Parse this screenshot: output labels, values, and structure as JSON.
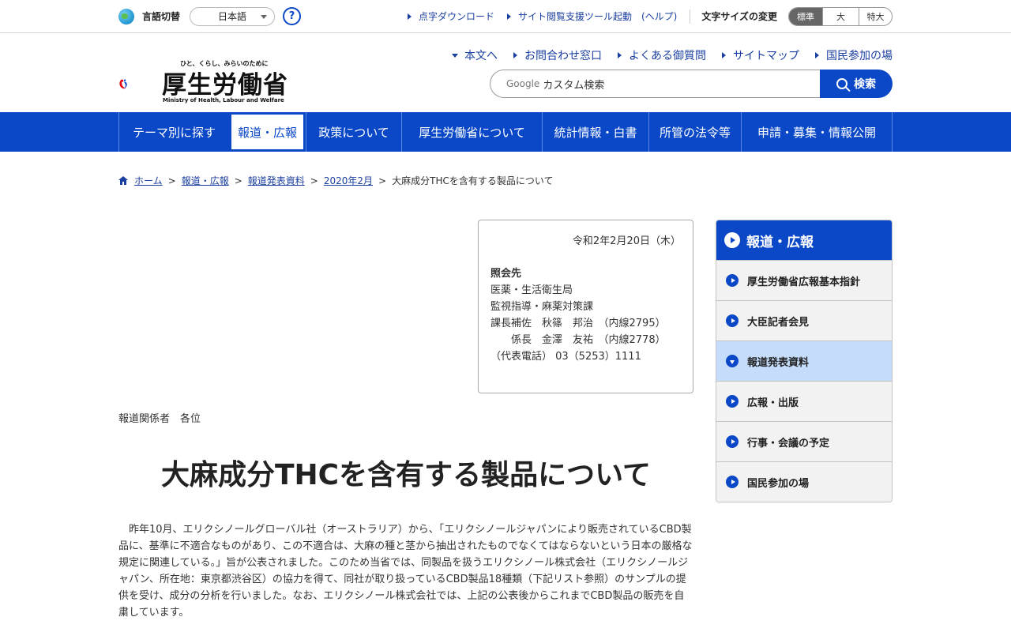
{
  "utility": {
    "lang_label": "言語切替",
    "lang_value": "日本語",
    "help_glyph": "?",
    "links": [
      "点字ダウンロード",
      "サイト閲覧支援ツール起動",
      "(ヘルプ)"
    ],
    "font_size_label": "文字サイズの変更",
    "font_sizes": [
      "標準",
      "大",
      "特大"
    ]
  },
  "logo": {
    "tagline": "ひと、くらし、みらいのために",
    "title": "厚生労働省",
    "english": "Ministry of Health, Labour and Welfare",
    "colors": {
      "red": "#e60012",
      "blue": "#0a48c8"
    }
  },
  "header": {
    "links": [
      "本文へ",
      "お問合わせ窓口",
      "よくある御質問",
      "サイトマップ",
      "国民参加の場"
    ],
    "search_brand": "Google",
    "search_placeholder": "カスタム検索",
    "search_button": "検索"
  },
  "gnav": {
    "items": [
      "テーマ別に探す",
      "報道・広報",
      "政策について",
      "厚生労働省について",
      "統計情報・白書",
      "所管の法令等",
      "申請・募集・情報公開"
    ]
  },
  "breadcrumb": {
    "items": [
      "ホーム",
      "報道・広報",
      "報道発表資料",
      "2020年2月"
    ],
    "current": "大麻成分THCを含有する製品について"
  },
  "contact": {
    "date": "令和2年2月20日（木）",
    "heading": "照会先",
    "lines": [
      "医薬・生活衛生局",
      "監視指導・麻薬対策課",
      "課長補佐　秋篠　邦治　（内線2795）",
      "　　係長　金澤　友祐　（内線2778）",
      "（代表電話） 03（5253）1111"
    ]
  },
  "article": {
    "to": "報道関係者　各位",
    "title": "大麻成分THCを含有する製品について",
    "body": "昨年10月、エリクシノールグローバル社（オーストラリア）から、「エリクシノールジャパンにより販売されているCBD製品に、基準に不適合なものがあり、この不適合は、大麻の種と茎から抽出されたものでなくてはならないという日本の厳格な規定に関連している。」旨が公表されました。このため当省では、同製品を扱うエリクシノール株式会社（エリクシノールジャパン、所在地：東京都渋谷区）の協力を得て、同社が取り扱っているCBD製品18種類（下記リスト参照）のサンプルの提供を受け、成分の分析を行いました。なお、エリクシノール株式会社では、上記の公表後からこれまでCBD製品の販売を自粛しています。"
  },
  "side": {
    "heading": "報道・広報",
    "items": [
      "厚生労働省広報基本指針",
      "大臣記者会見",
      "報道発表資料",
      "広報・出版",
      "行事・会議の予定",
      "国民参加の場"
    ],
    "active_index": 2
  }
}
